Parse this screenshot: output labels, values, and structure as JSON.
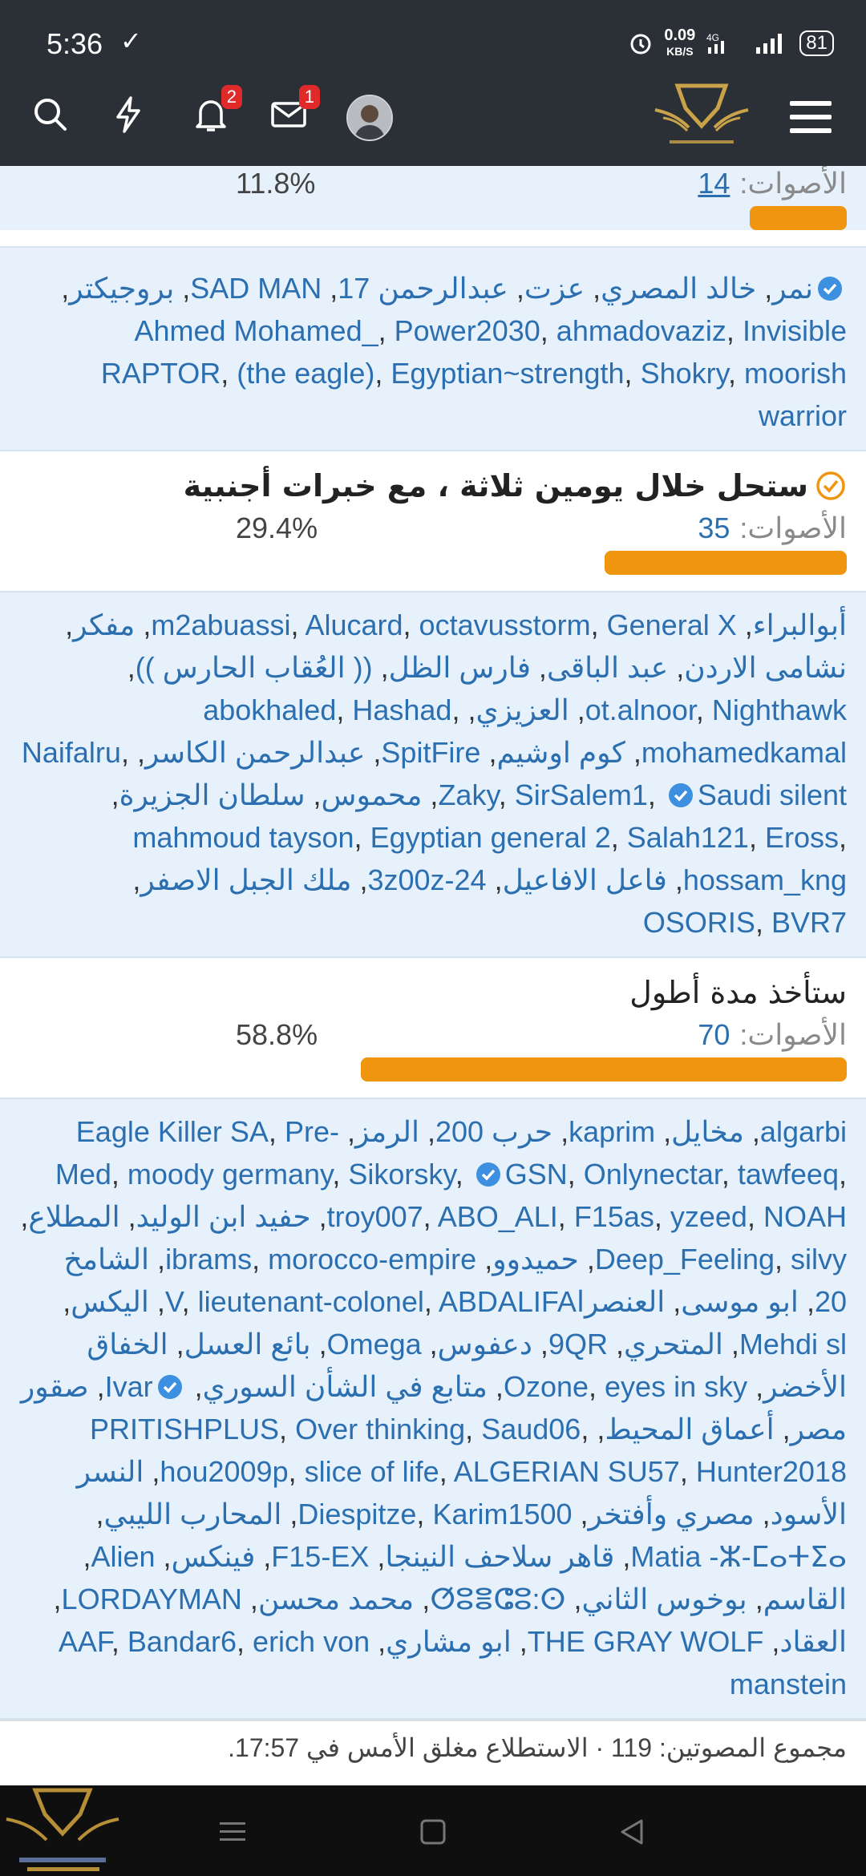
{
  "status": {
    "time": "5:36",
    "speed_value": "0.09",
    "speed_unit": "KB/S",
    "network": "4G",
    "battery": "81"
  },
  "topbar": {
    "notifications_badge": "2",
    "messages_badge": "1"
  },
  "options": [
    {
      "votes_label": "الأصوات:",
      "votes_count": "14",
      "percent": "11.8%",
      "fraction": 0.118,
      "voters_html": "نمر <V> خالد المصري, عزت, عبدالرحمن 17, SAD MAN, برووجيكتر, Ahmed Mohamed_, Power2030, ahmadovaziz, Invisible RAPTOR, (the eagle), Egyptian~strength, Shokry, moorish warrior"
    },
    {
      "title": "ستحل خلال يومين ثلاثة ، مع خبرات أجنبية",
      "votes_label": "الأصوات:",
      "votes_count": "35",
      "percent": "29.4%",
      "fraction": 0.294
    },
    {
      "title": "ستأخذ مدة أطول",
      "votes_label": "الأصوات:",
      "votes_count": "70",
      "percent": "58.8%",
      "fraction": 0.588
    }
  ],
  "voters_option1": [
    "نمر",
    "خالد المصري",
    "عزت",
    "عبدالرحمن 17",
    "SAD MAN",
    "بروجيكتر",
    "Ahmed Mohamed_",
    "Power2030",
    "ahmadovaziz",
    "Invisible RAPTOR",
    "(the eagle)",
    "Egyptian~strength",
    "Shokry",
    "moorish warrior"
  ],
  "voters_option2": [
    "أبوالبراء",
    "m2abuassi",
    "Alucard",
    "octavusstorm",
    "General X",
    "مفكر",
    "نشامى الاردن",
    "عبد الباقى",
    "فارس الظل",
    "(( العُقاب الحارس ))",
    "ot.alnoor",
    "Nighthawk",
    "العزيزي",
    "abokhaled",
    "Hashad",
    "mohamedkamal",
    "كوم اوشيم",
    "SpitFire",
    "عبدالرحمن الكاسر",
    "Naifalru",
    "Zaky",
    "SirSalem1",
    "Saudi silent",
    "محموس",
    "سلطان الجزيرة",
    "mahmoud tayson",
    "Egyptian general 2",
    "Salah121",
    "Eross",
    "hossam_kng",
    "فاعل الافاعيل",
    "3z00z-24",
    "ملك الجبل الاصفر",
    "OSORIS",
    "BVR7"
  ],
  "voters_option3": [
    "algarbi",
    "مخايل",
    "kaprim",
    "حرب 200",
    "الرمز",
    "Eagle Killer SA",
    "Pre-Med",
    "moody germany",
    "Sikorsky",
    "GSN",
    "Onlynectar",
    "tawfeeq",
    "troy007",
    "ABO_ALI",
    "F15as",
    "yzeed",
    "NOAH",
    "حفيد ابن الوليد",
    "المطلاع",
    "Deep_Feeling",
    "silvy",
    "حميدوو",
    "ibrams",
    "morocco-empire",
    "الشامخ 20",
    "ابو موسى",
    "العنصراV",
    "lieutenant-colonel",
    "ABDALIFA",
    "اليكس",
    "Mehdi sl",
    "المتحري",
    "9QR",
    "دعفوس",
    "Omega",
    "بائع العسل",
    "الخفاق الأخضر",
    "Ozone",
    "eyes in sky",
    "متابع في الشأن السوري",
    "Ivar",
    "صقور مصر",
    "أعماق المحيط",
    "PRITISHPLUS",
    "Over thinking",
    "Saud06",
    "hou2009p",
    "slice of life",
    "ALGERIAN SU57",
    "Hunter2018",
    "النسر الأسود",
    "مصري وأفتخر",
    "Diespitze",
    "Karim1500",
    "المحارب الليبي",
    "Matia -ⵣ-ⵎⴰⵜⵉⴰ",
    "قاهر سلاحف النينجا",
    "F15-EX",
    "فينكس",
    "Alien",
    "القاسم",
    "بوخوس الثاني",
    "ⵚⵓⴻⵛⵓ:ⵙ",
    "محمد محسن",
    "LORDAYMAN",
    "العقاد",
    "THE GRAY WOLF",
    "ابو مشاري",
    "AAF",
    "Bandar6",
    "erich von manstein"
  ],
  "footer": {
    "total_label": "مجموع المصوتين:",
    "total": "119",
    "closed_text": "· الاستطلاع مغلق الأمس في 17:57."
  }
}
